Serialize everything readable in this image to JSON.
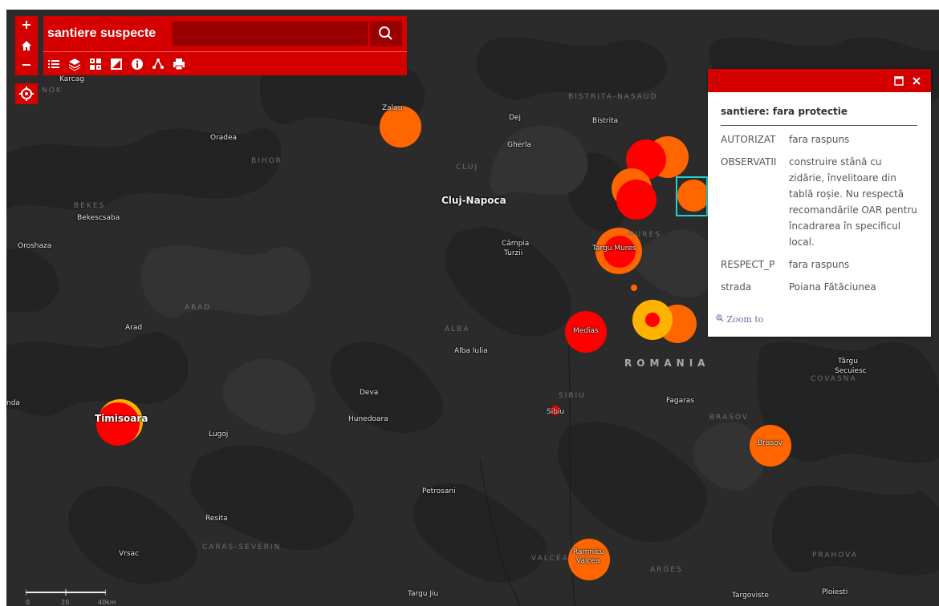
{
  "app": {
    "title": "santiere suspecte",
    "search_placeholder": "",
    "accent_color": "#d40000"
  },
  "controls": {
    "zoom_in": "+",
    "home": "home-icon",
    "zoom_out": "−",
    "locate": "locate-icon"
  },
  "toolbar": {
    "tools": [
      "list-icon",
      "layers-icon",
      "basemap-gallery-icon",
      "legend-icon",
      "info-icon",
      "measure-icon",
      "print-icon"
    ]
  },
  "map": {
    "cities": [
      {
        "name": "Karcag"
      },
      {
        "name": "Zalau"
      },
      {
        "name": "Dej"
      },
      {
        "name": "Bistrita"
      },
      {
        "name": "Gherla"
      },
      {
        "name": "Oradea"
      },
      {
        "name": "Cluj-Napoca"
      },
      {
        "name": "Bekescsaba"
      },
      {
        "name": "Oroshaza"
      },
      {
        "name": "Câmpia"
      },
      {
        "name": "Turzii"
      },
      {
        "name": "Targu Mures"
      },
      {
        "name": "Arad"
      },
      {
        "name": "Medias"
      },
      {
        "name": "Alba Iulia"
      },
      {
        "name": "Târgu"
      },
      {
        "name": "Secuiesc"
      },
      {
        "name": "Deva"
      },
      {
        "name": "Hunedoara"
      },
      {
        "name": "Sibiu"
      },
      {
        "name": "Fagaras"
      },
      {
        "name": "Timisoara"
      },
      {
        "name": "Lugoj"
      },
      {
        "name": "Brasov"
      },
      {
        "name": "Petrosani"
      },
      {
        "name": "Resita"
      },
      {
        "name": "Vrsac"
      },
      {
        "name": "Ramnicu"
      },
      {
        "name": "Valcea"
      },
      {
        "name": "Targu Jiu"
      },
      {
        "name": "Targoviste"
      },
      {
        "name": "Ploiesti"
      },
      {
        "name": "nda"
      }
    ],
    "regions": [
      "BISTRITA-NASAUD",
      "BIHOR",
      "CLUJ",
      "BEKES",
      "ARAD",
      "ALBA",
      "SIBIU",
      "BRASOV",
      "COVASNA",
      "CARAS-SEVERIN",
      "VALCEA",
      "ARGES",
      "PRAHOVA",
      "MURES",
      "NOK"
    ],
    "country": "ROMANIA",
    "marker_colors": {
      "red": "#ff0000",
      "orange": "#ff6600",
      "yellow": "#ffb300"
    },
    "scalebar": {
      "labels": [
        "0",
        "20",
        "40km"
      ]
    }
  },
  "popup": {
    "title": "santiere: fara protectie",
    "fields": [
      {
        "key": "AUTORIZAT",
        "value": "fara raspuns"
      },
      {
        "key": "OBSERVATII",
        "value": "construire stână cu zidărie, învelitoare din tablă roșie. Nu respectă recomandările OAR pentru încadrarea în specificul local."
      },
      {
        "key": "RESPECT_P",
        "value": "fara raspuns"
      },
      {
        "key": "strada",
        "value": "Poiana Fătăciunea"
      }
    ],
    "zoom_to": "Zoom to",
    "maximize_icon": "maximize-icon",
    "close_icon": "close-icon"
  }
}
